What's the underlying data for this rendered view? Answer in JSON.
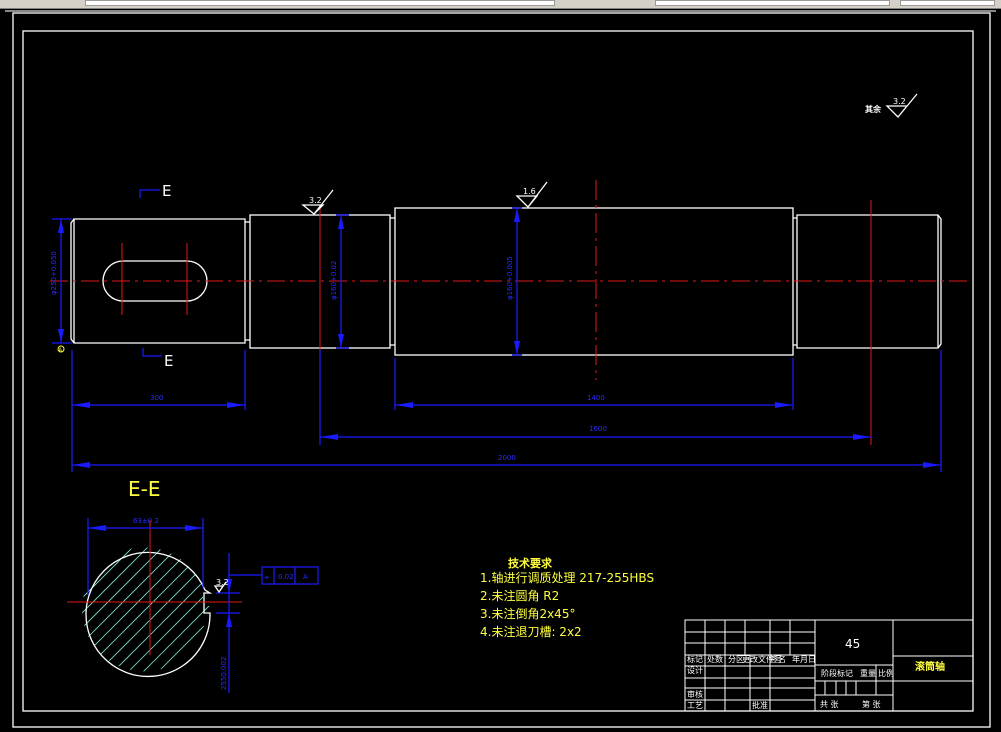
{
  "drawing": {
    "section_marker": "E",
    "section_title": "E-E",
    "roughness_other": "其余",
    "roughness_values": [
      "3.2",
      "3.2",
      "1.6",
      "3.2"
    ],
    "dimensions": {
      "d1": "φ250+0.050",
      "d2": "φ160+0.02",
      "d3": "φ160+0.005",
      "len_300": "300",
      "len_1400": "1400",
      "len_1600": "1600",
      "len_2000": "2000",
      "section_width": "63±0.2",
      "section_depth": "2550.002"
    },
    "datum": "A",
    "tolerance_frame": {
      "symbol": "⌯",
      "value": "0.02",
      "datum": "A"
    },
    "tech_requirements": {
      "title": "技术要求",
      "items": [
        "1.轴进行调质处理 217-255HBS",
        "2.未注圆角 R2",
        "3.未注倒角2x45°",
        "4.未注退刀槽: 2x2"
      ]
    }
  },
  "title_block": {
    "material": "45",
    "part_name": "滚筒轴",
    "labels": [
      "标记",
      "处数",
      "分区",
      "更改文件号",
      "签名",
      "年月日"
    ],
    "design": "设计",
    "review": "审核",
    "process": "工艺",
    "approve": "批准",
    "stage_mark": "阶段标记",
    "weight": "重量",
    "scale": "比例",
    "total_sheets": "共 张",
    "sheet_no": "第 张"
  },
  "colors": {
    "background": "#000000",
    "outline": "#ffffff",
    "centerline": "#e01818",
    "dimension": "#1a1aff",
    "text": "#ffff40",
    "hatch": "#7fe8d8"
  }
}
